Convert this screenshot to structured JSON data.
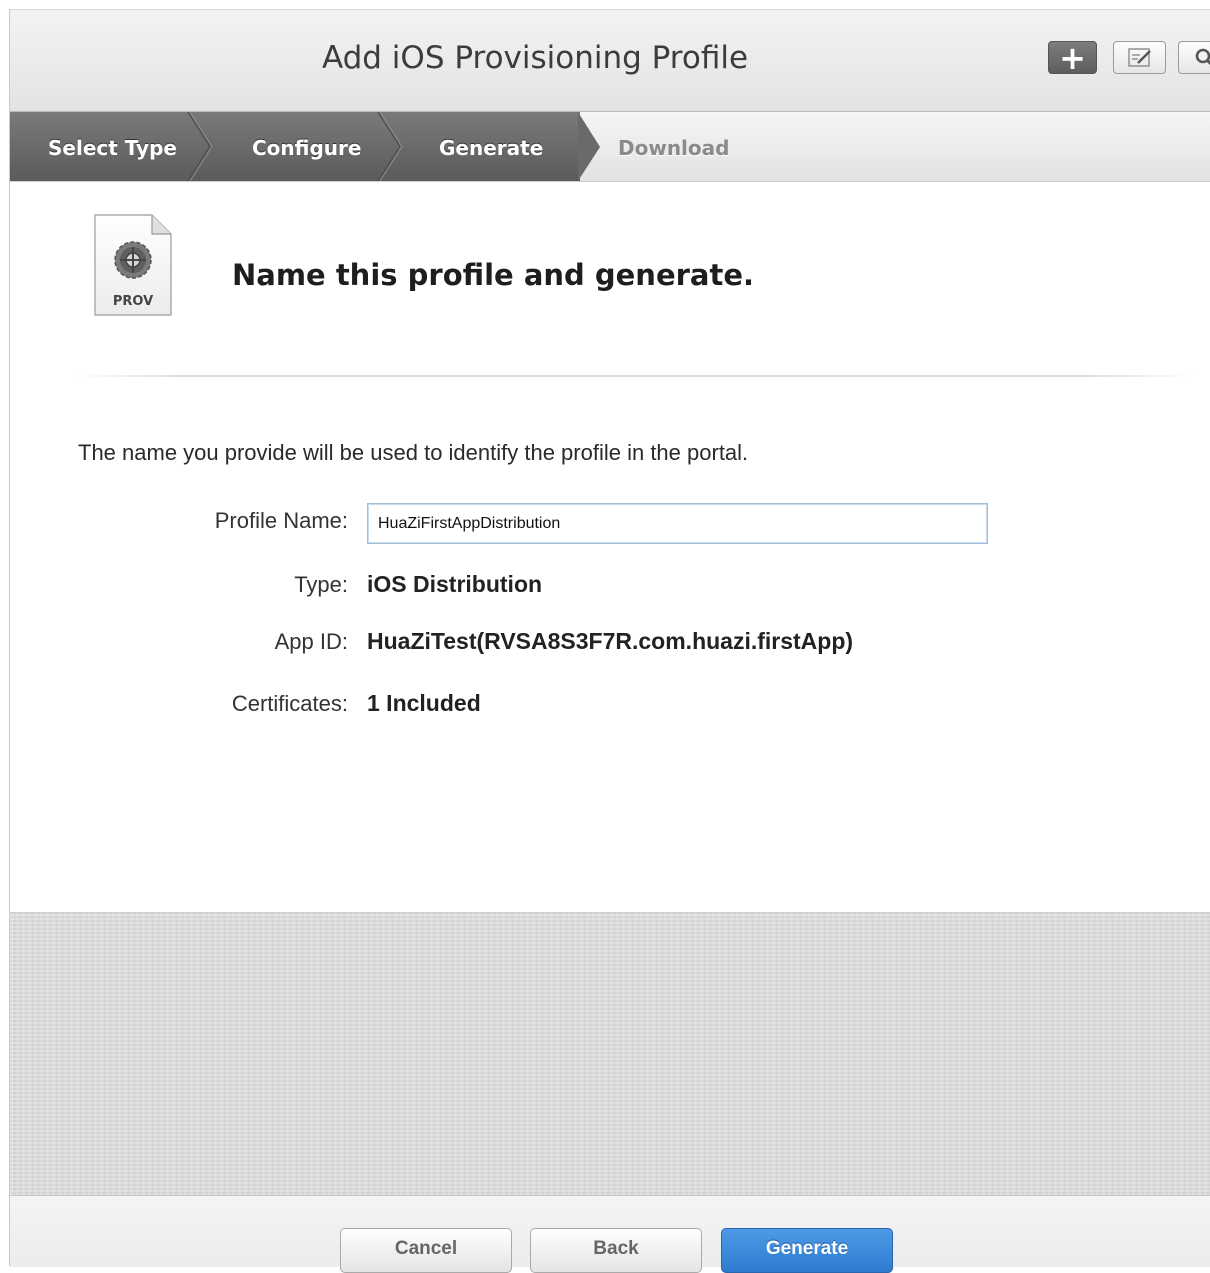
{
  "header": {
    "title": "Add iOS Provisioning Profile",
    "buttons": [
      {
        "name": "add",
        "icon": "plus-icon"
      },
      {
        "name": "edit",
        "icon": "edit-icon"
      },
      {
        "name": "search",
        "icon": "search-icon"
      }
    ]
  },
  "steps": [
    {
      "label": "Select Type",
      "state": "done"
    },
    {
      "label": "Configure",
      "state": "done"
    },
    {
      "label": "Generate",
      "state": "current"
    },
    {
      "label": "Download",
      "state": "pending"
    }
  ],
  "content": {
    "icon_label": "PROV",
    "heading": "Name this profile and generate.",
    "description": "The name you provide will be used to identify the profile in the portal.",
    "fields": {
      "profile_name": {
        "label": "Profile Name:",
        "value": "HuaZiFirstAppDistribution"
      },
      "type": {
        "label": "Type:",
        "value": "iOS Distribution"
      },
      "app_id": {
        "label": "App ID:",
        "value": "HuaZiTest(RVSA8S3F7R.com.huazi.firstApp)"
      },
      "certificates": {
        "label": "Certificates:",
        "value": "1 Included"
      }
    }
  },
  "footer": {
    "cancel_label": "Cancel",
    "back_label": "Back",
    "generate_label": "Generate"
  },
  "colors": {
    "primary_button": "#2e7bd1",
    "steps_active": "#6a6a6a"
  }
}
